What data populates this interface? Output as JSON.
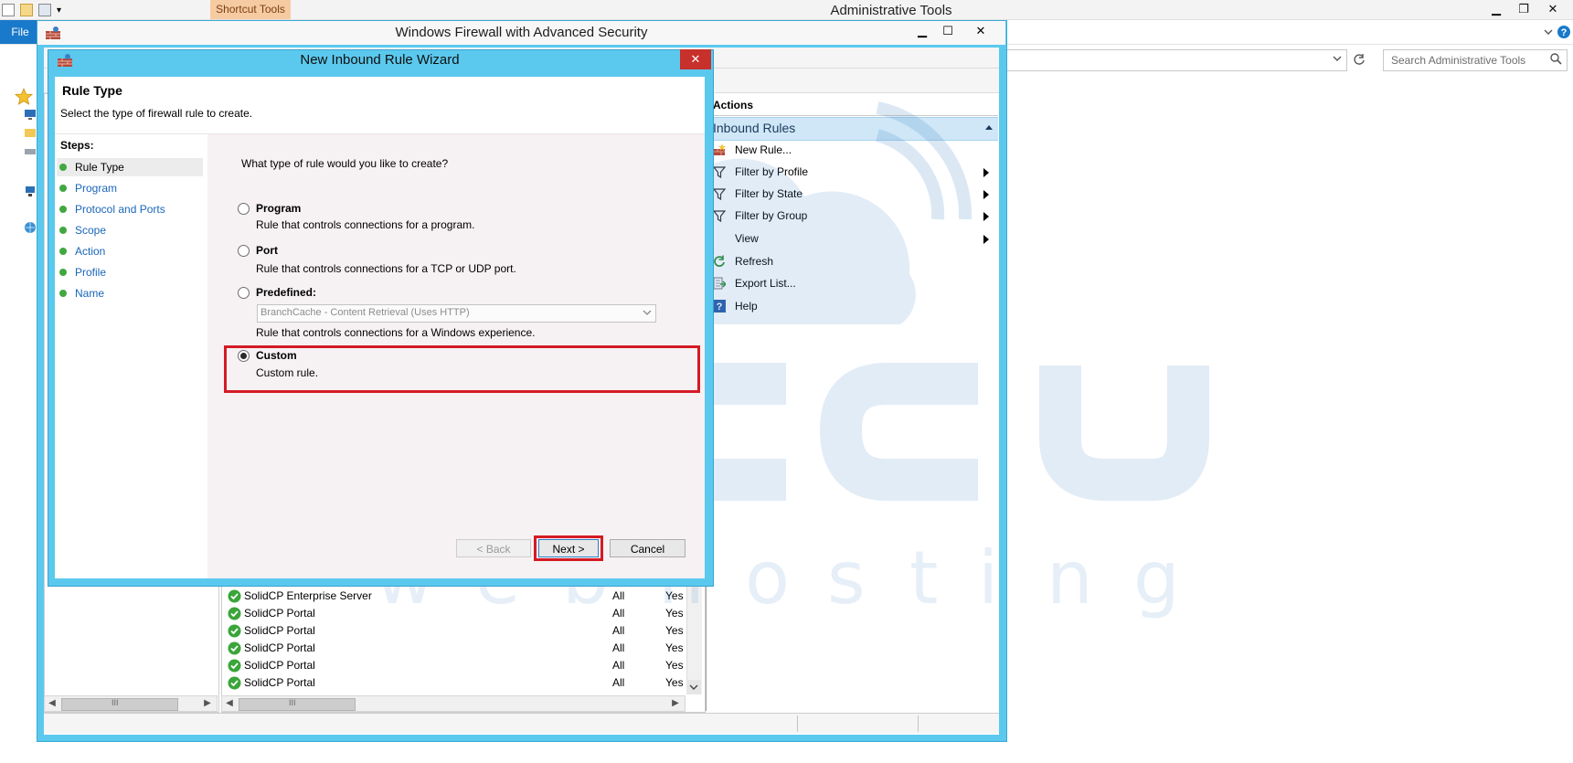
{
  "explorer": {
    "title": "Administrative Tools",
    "contextual_tab": "Shortcut Tools",
    "file_tab": "File",
    "search_placeholder": "Search Administrative Tools",
    "controls": {
      "minimize": "▁",
      "restore": "❐",
      "close": "✕"
    }
  },
  "firewall": {
    "title": "Windows Firewall with Advanced Security",
    "controls": {
      "minimize": "▁",
      "maximize": "☐",
      "close": "✕"
    },
    "actions": {
      "header": "Actions",
      "section": "Inbound Rules",
      "items": [
        {
          "label": "New Rule...",
          "icon": "new-rule-icon",
          "submenu": false
        },
        {
          "label": "Filter by Profile",
          "icon": "filter-icon",
          "submenu": true
        },
        {
          "label": "Filter by State",
          "icon": "filter-icon",
          "submenu": true
        },
        {
          "label": "Filter by Group",
          "icon": "filter-icon",
          "submenu": true
        },
        {
          "label": "View",
          "icon": "",
          "submenu": true
        },
        {
          "label": "Refresh",
          "icon": "refresh-icon",
          "submenu": false
        },
        {
          "label": "Export List...",
          "icon": "export-icon",
          "submenu": false
        },
        {
          "label": "Help",
          "icon": "help-icon",
          "submenu": false
        }
      ]
    },
    "rules": [
      {
        "name": "SolidCP Enterprise Server",
        "profile": "All",
        "enabled": "Yes"
      },
      {
        "name": "SolidCP Portal",
        "profile": "All",
        "enabled": "Yes"
      },
      {
        "name": "SolidCP Portal",
        "profile": "All",
        "enabled": "Yes"
      },
      {
        "name": "SolidCP Portal",
        "profile": "All",
        "enabled": "Yes"
      },
      {
        "name": "SolidCP Portal",
        "profile": "All",
        "enabled": "Yes"
      },
      {
        "name": "SolidCP Portal",
        "profile": "All",
        "enabled": "Yes"
      }
    ],
    "scroll_thumb_glyph": "III"
  },
  "wizard": {
    "title": "New Inbound Rule Wizard",
    "close": "✕",
    "header_title": "Rule Type",
    "header_desc": "Select the type of firewall rule to create.",
    "steps_label": "Steps:",
    "steps": [
      "Rule Type",
      "Program",
      "Protocol and Ports",
      "Scope",
      "Action",
      "Profile",
      "Name"
    ],
    "question": "What type of rule would you like to create?",
    "options": {
      "program": {
        "title": "Program",
        "desc": "Rule that controls connections for a program."
      },
      "port": {
        "title": "Port",
        "desc": "Rule that controls connections for a TCP or UDP port."
      },
      "predefined": {
        "title": "Predefined:",
        "desc": "Rule that controls connections for a Windows experience.",
        "select_value": "BranchCache - Content Retrieval (Uses HTTP)"
      },
      "custom": {
        "title": "Custom",
        "desc": "Custom rule."
      }
    },
    "selected_option": "custom",
    "buttons": {
      "back": "< Back",
      "next": "Next >",
      "cancel": "Cancel"
    }
  },
  "colors": {
    "accent": "#1979ca",
    "dialog_frame": "#5bc9ee",
    "highlight": "#d41b24",
    "watermark": "#3a82c4"
  }
}
